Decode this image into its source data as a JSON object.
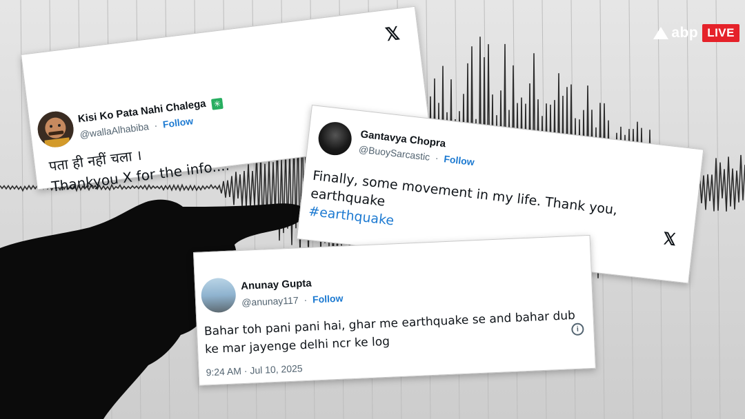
{
  "watermark": {
    "brand": "abp",
    "live_label": "LIVE",
    "colors": {
      "live_bg": "#e5222a"
    }
  },
  "tweets": [
    {
      "name": "Kisi Ko Pata Nahi Chalega",
      "badge_icon": "verified-sparkle-icon",
      "handle": "@wallaAlhabiba",
      "separator": "·",
      "follow_label": "Follow",
      "text_lines": [
        "पता ही नहीं चला ।",
        "Thankyou X for the info...."
      ],
      "platform_icon": "x-logo-icon"
    },
    {
      "name": "Gantavya Chopra",
      "handle": "@BuoySarcastic",
      "separator": "·",
      "follow_label": "Follow",
      "text": "Finally, some movement in my life. Thank you, earthquake",
      "hashtag": "#earthquake",
      "platform_icon": "x-logo-icon"
    },
    {
      "name": "Anunay Gupta",
      "handle": "@anunay117",
      "separator": "·",
      "follow_label": "Follow",
      "text": "Bahar toh pani pani hai, ghar me earthquake se and bahar dub ke mar jayenge delhi ncr ke log",
      "timestamp": "9:24 AM · Jul 10, 2025",
      "info_icon": "info-icon"
    }
  ],
  "colors": {
    "follow": "#1d7ad1",
    "hashtag": "#1d7ad1",
    "text": "#0f1419",
    "muted": "#536471"
  }
}
